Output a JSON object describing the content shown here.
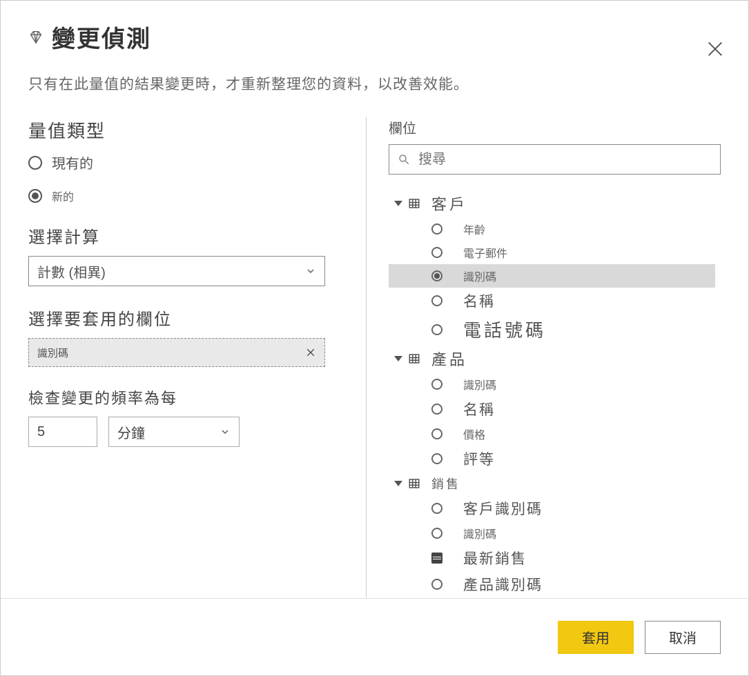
{
  "header": {
    "title": "變更偵測",
    "subtitle": "只有在此量值的結果變更時，才重新整理您的資料，以改善效能。"
  },
  "measure_type": {
    "title": "量值類型",
    "options": {
      "existing": "現有的",
      "new": "新的"
    },
    "selected": "new"
  },
  "calculation": {
    "title": "選擇計算",
    "value": "計數 (相異)"
  },
  "apply_field": {
    "title": "選擇要套用的欄位",
    "chip": "識別碼"
  },
  "frequency": {
    "title": "檢查變更的頻率為每",
    "value": "5",
    "unit": "分鐘"
  },
  "fields": {
    "label": "欄位",
    "search_placeholder": "搜尋",
    "tables": [
      {
        "name": "客戶",
        "size": "lg",
        "fields": [
          {
            "name": "年齡",
            "size": "sm",
            "selected": false,
            "type": "radio"
          },
          {
            "name": "電子郵件",
            "size": "sm",
            "selected": false,
            "type": "radio"
          },
          {
            "name": "識別碼",
            "size": "sm",
            "selected": true,
            "type": "radio"
          },
          {
            "name": "名稱",
            "size": "md",
            "selected": false,
            "type": "radio"
          },
          {
            "name": "電話號碼",
            "size": "lg",
            "selected": false,
            "type": "radio"
          }
        ]
      },
      {
        "name": "產品",
        "size": "lg",
        "fields": [
          {
            "name": "識別碼",
            "size": "sm",
            "selected": false,
            "type": "radio"
          },
          {
            "name": "名稱",
            "size": "md",
            "selected": false,
            "type": "radio"
          },
          {
            "name": "價格",
            "size": "sm",
            "selected": false,
            "type": "radio"
          },
          {
            "name": "評等",
            "size": "md",
            "selected": false,
            "type": "radio"
          }
        ]
      },
      {
        "name": "銷售",
        "size": "sm",
        "fields": [
          {
            "name": "客戶識別碼",
            "size": "md",
            "selected": false,
            "type": "radio"
          },
          {
            "name": "識別碼",
            "size": "sm",
            "selected": false,
            "type": "radio"
          },
          {
            "name": "最新銷售",
            "size": "md",
            "selected": false,
            "type": "calc"
          },
          {
            "name": "產品識別碼",
            "size": "md",
            "selected": false,
            "type": "radio"
          }
        ]
      }
    ]
  },
  "footer": {
    "apply": "套用",
    "cancel": "取消"
  }
}
